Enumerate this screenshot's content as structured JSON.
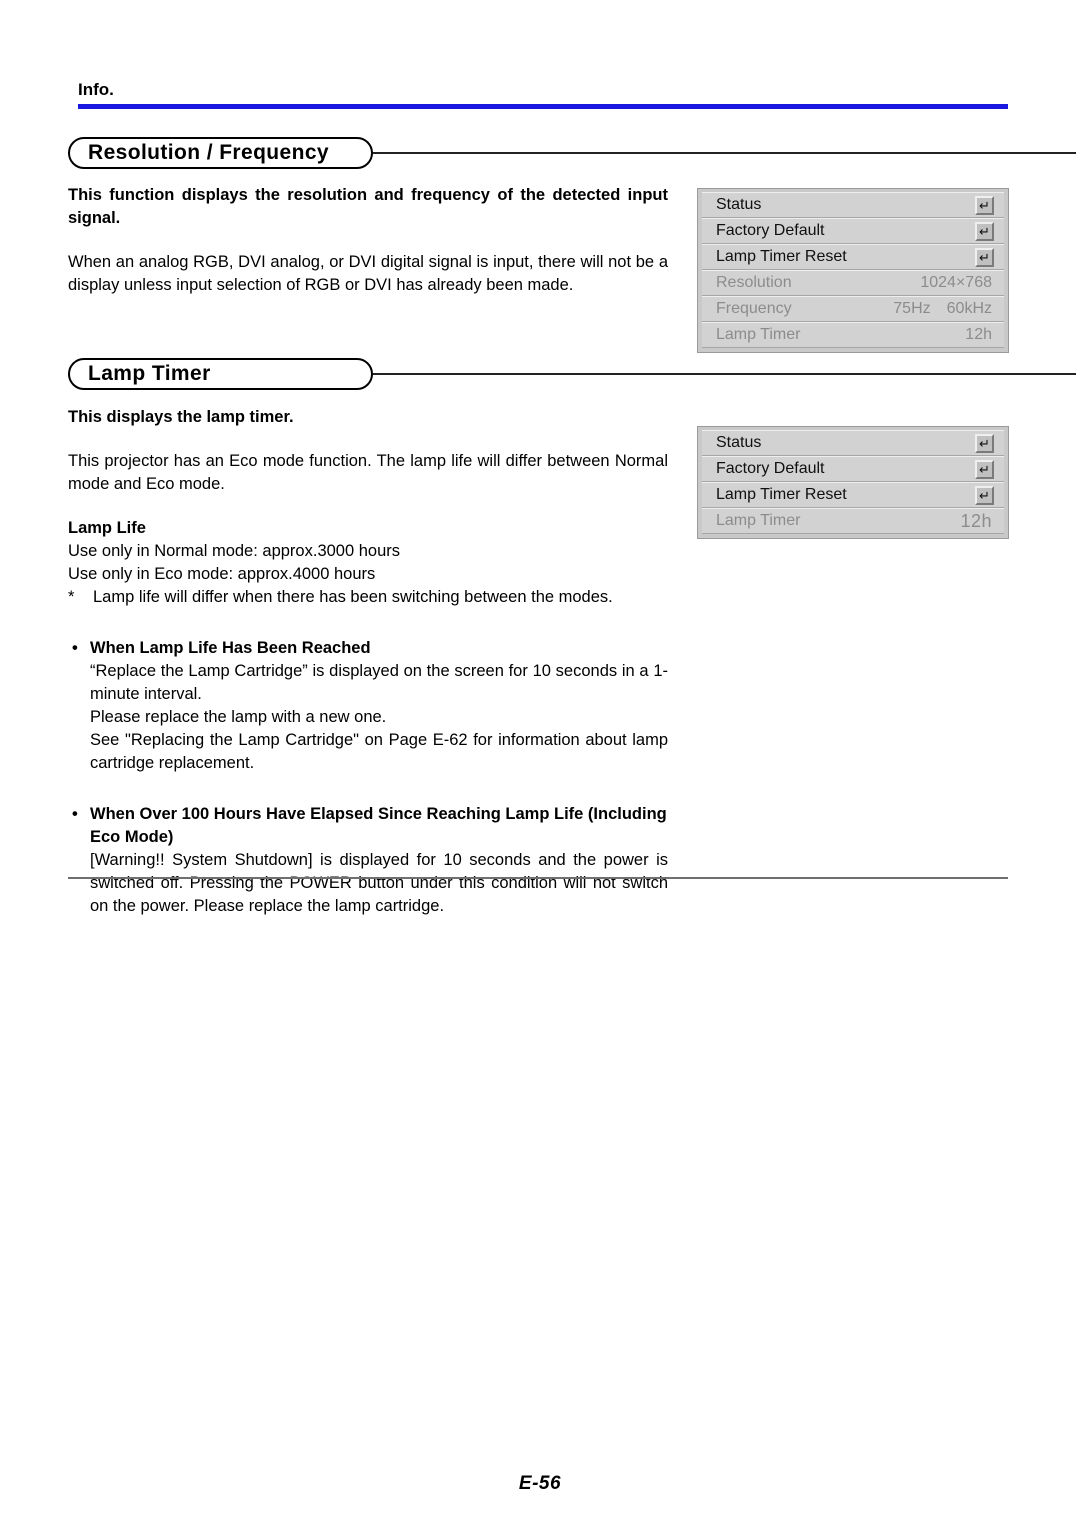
{
  "page": {
    "info_label": "Info.",
    "footer": "E-56",
    "accent_color": "#1818e0",
    "rule_color": "#6f6f6f"
  },
  "sections": [
    {
      "id": "resolution-frequency",
      "title": "Resolution / Frequency",
      "intro_bold": "This function displays the resolution and frequency of the detected input signal.",
      "paragraph": "When an analog RGB, DVI analog, or DVI digital signal is input, there will not be a display unless input selection of RGB or DVI has already been made."
    },
    {
      "id": "lamp-timer",
      "title": "Lamp Timer",
      "intro_bold": "This displays the lamp timer.",
      "paragraph": "This projector has an Eco mode function. The lamp life will differ between Normal mode and Eco mode.",
      "lamp_life": {
        "heading": "Lamp Life",
        "line1": "Use only in Normal mode: approx.3000 hours",
        "line2": "Use only in Eco mode: approx.4000 hours",
        "note_marker": "*",
        "note": "Lamp life will differ when there has been switching between the modes."
      },
      "bullets": [
        {
          "marker": "•",
          "heading": "When Lamp Life Has Been Reached",
          "lines": [
            "“Replace the Lamp Cartridge” is displayed on the screen for 10 seconds in a 1-minute interval.",
            "Please replace the lamp with a new one.",
            "See \"Replacing the Lamp Cartridge\" on Page E-62 for information about lamp cartridge replacement."
          ]
        },
        {
          "marker": "•",
          "heading": "When Over 100 Hours Have Elapsed Since Reaching Lamp Life (Including Eco Mode)",
          "lines": [
            "[Warning!! System Shutdown] is displayed for 10 seconds and the power is switched off. Pressing the POWER button under this condition will not switch on the power. Please replace the lamp cartridge."
          ]
        }
      ]
    }
  ],
  "osd_menus": [
    {
      "id": "osd-resolution-frequency",
      "rows": [
        {
          "label": "Status",
          "value": "",
          "value2": "",
          "icon": "enter-key-icon",
          "dim": false
        },
        {
          "label": "Factory Default",
          "value": "",
          "value2": "",
          "icon": "enter-key-icon",
          "dim": false
        },
        {
          "label": "Lamp Timer Reset",
          "value": "",
          "value2": "",
          "icon": "enter-key-icon",
          "dim": false
        },
        {
          "label": "Resolution",
          "value": "1024×768",
          "value2": "",
          "icon": "",
          "dim": true
        },
        {
          "label": "Frequency",
          "value": "75Hz",
          "value2": "60kHz",
          "icon": "",
          "dim": true
        },
        {
          "label": "Lamp Timer",
          "value": "12h",
          "value2": "",
          "icon": "",
          "dim": true
        }
      ]
    },
    {
      "id": "osd-lamp-timer",
      "rows": [
        {
          "label": "Status",
          "value": "",
          "value2": "",
          "icon": "enter-key-icon",
          "dim": false
        },
        {
          "label": "Factory Default",
          "value": "",
          "value2": "",
          "icon": "enter-key-icon",
          "dim": false
        },
        {
          "label": "Lamp Timer Reset",
          "value": "",
          "value2": "",
          "icon": "enter-key-icon",
          "dim": false
        },
        {
          "label": "Lamp Timer",
          "value": "12h",
          "value2": "",
          "icon": "",
          "dim": true,
          "big": true
        }
      ]
    }
  ],
  "icons": {
    "enter_key": "↵"
  }
}
